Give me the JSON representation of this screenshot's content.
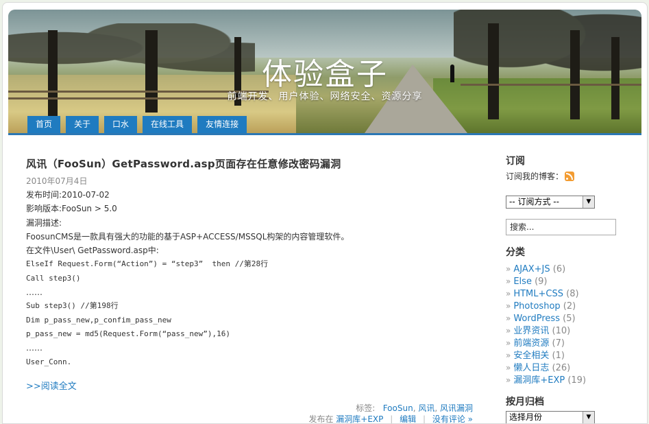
{
  "header": {
    "title": "体验盒子",
    "description": "前端开发、用户体验、网络安全、资源分享"
  },
  "nav": [
    {
      "label": "首页"
    },
    {
      "label": "关于"
    },
    {
      "label": "口水"
    },
    {
      "label": "在线工具"
    },
    {
      "label": "友情连接"
    }
  ],
  "post": {
    "title": "风讯（FooSun）GetPassword.asp页面存在任意修改密码漏洞",
    "date": "2010年07月4日",
    "lines": [
      "发布时间:2010-07-02",
      "影响版本:FooSun > 5.0",
      "漏洞描述:",
      "FoosunCMS是一款具有强大的功能的基于ASP+ACCESS/MSSQL构架的内容管理软件。",
      "在文件\\User\\ GetPassword.asp中:",
      "ElseIf Request.Form(“Action”) = “step3”  then //第28行",
      "Call step3()",
      "……",
      "Sub step3() //第198行",
      "Dim p_pass_new,p_confim_pass_new",
      "p_pass_new = md5(Request.Form(“pass_new”),16)",
      "……",
      "User_Conn."
    ],
    "read_more": ">>阅读全文",
    "tags_label": "标签:",
    "tags": [
      "FooSun",
      "风讯",
      "风讯漏洞"
    ],
    "posted_in_label": "发布在",
    "category": "漏洞库+EXP",
    "edit_label": "编辑",
    "comments_label": "没有评论 »"
  },
  "sidebar": {
    "subscribe_heading": "订阅",
    "subscribe_text": "订阅我的博客：",
    "subscribe_select": "-- 订阅方式 --",
    "search_placeholder": "搜索...",
    "categories_heading": "分类",
    "categories": [
      {
        "name": "AJAX+JS",
        "count": "(6)"
      },
      {
        "name": "Else",
        "count": "(9)"
      },
      {
        "name": "HTML+CSS",
        "count": "(8)"
      },
      {
        "name": "Photoshop",
        "count": "(2)"
      },
      {
        "name": "WordPress",
        "count": "(5)"
      },
      {
        "name": "业界资讯",
        "count": "(10)"
      },
      {
        "name": "前端资源",
        "count": "(7)"
      },
      {
        "name": "安全相关",
        "count": "(1)"
      },
      {
        "name": "懒人日志",
        "count": "(26)"
      },
      {
        "name": "漏洞库+EXP",
        "count": "(19)"
      }
    ],
    "archive_heading": "按月归档",
    "archive_select": "选择月份"
  }
}
